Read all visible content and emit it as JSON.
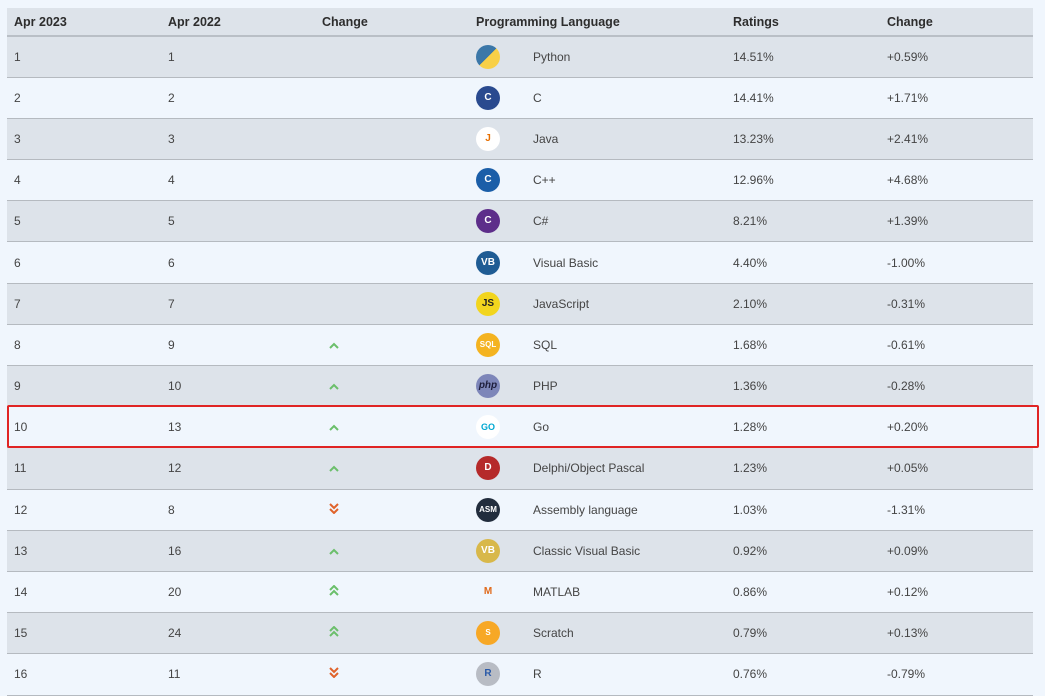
{
  "headers": [
    "Apr 2023",
    "Apr 2022",
    "Change",
    "Programming Language",
    "Ratings",
    "Change"
  ],
  "rows": [
    {
      "apr2023": "1",
      "apr2022": "1",
      "trend": "",
      "icon": "python-icon",
      "language": "Python",
      "rating": "14.51%",
      "change": "+0.59%"
    },
    {
      "apr2023": "2",
      "apr2022": "2",
      "trend": "",
      "icon": "c-icon",
      "language": "C",
      "rating": "14.41%",
      "change": "+1.71%"
    },
    {
      "apr2023": "3",
      "apr2022": "3",
      "trend": "",
      "icon": "java-icon",
      "language": "Java",
      "rating": "13.23%",
      "change": "+2.41%"
    },
    {
      "apr2023": "4",
      "apr2022": "4",
      "trend": "",
      "icon": "cpp-icon",
      "language": "C++",
      "rating": "12.96%",
      "change": "+4.68%"
    },
    {
      "apr2023": "5",
      "apr2022": "5",
      "trend": "",
      "icon": "csharp-icon",
      "language": "C#",
      "rating": "8.21%",
      "change": "+1.39%"
    },
    {
      "apr2023": "6",
      "apr2022": "6",
      "trend": "",
      "icon": "visual-basic-icon",
      "language": "Visual Basic",
      "rating": "4.40%",
      "change": "-1.00%"
    },
    {
      "apr2023": "7",
      "apr2022": "7",
      "trend": "",
      "icon": "javascript-icon",
      "language": "JavaScript",
      "rating": "2.10%",
      "change": "-0.31%"
    },
    {
      "apr2023": "8",
      "apr2022": "9",
      "trend": "up",
      "icon": "sql-icon",
      "language": "SQL",
      "rating": "1.68%",
      "change": "-0.61%"
    },
    {
      "apr2023": "9",
      "apr2022": "10",
      "trend": "up",
      "icon": "php-icon",
      "language": "PHP",
      "rating": "1.36%",
      "change": "-0.28%"
    },
    {
      "apr2023": "10",
      "apr2022": "13",
      "trend": "up",
      "icon": "go-icon",
      "language": "Go",
      "rating": "1.28%",
      "change": "+0.20%"
    },
    {
      "apr2023": "11",
      "apr2022": "12",
      "trend": "up",
      "icon": "delphi-icon",
      "language": "Delphi/Object Pascal",
      "rating": "1.23%",
      "change": "+0.05%"
    },
    {
      "apr2023": "12",
      "apr2022": "8",
      "trend": "down2",
      "icon": "assembly-icon",
      "language": "Assembly language",
      "rating": "1.03%",
      "change": "-1.31%"
    },
    {
      "apr2023": "13",
      "apr2022": "16",
      "trend": "up",
      "icon": "classic-vb-icon",
      "language": "Classic Visual Basic",
      "rating": "0.92%",
      "change": "+0.09%"
    },
    {
      "apr2023": "14",
      "apr2022": "20",
      "trend": "up2",
      "icon": "matlab-icon",
      "language": "MATLAB",
      "rating": "0.86%",
      "change": "+0.12%"
    },
    {
      "apr2023": "15",
      "apr2022": "24",
      "trend": "up2",
      "icon": "scratch-icon",
      "language": "Scratch",
      "rating": "0.79%",
      "change": "+0.13%"
    },
    {
      "apr2023": "16",
      "apr2022": "11",
      "trend": "down2",
      "icon": "r-icon",
      "language": "R",
      "rating": "0.76%",
      "change": "-0.79%"
    }
  ],
  "icon_glyphs": {
    "python-icon": "Py",
    "c-icon": "C",
    "java-icon": "J",
    "cpp-icon": "C",
    "csharp-icon": "C",
    "visual-basic-icon": "VB",
    "javascript-icon": "JS",
    "sql-icon": "SQL",
    "php-icon": "php",
    "go-icon": "GO",
    "delphi-icon": "D",
    "assembly-icon": "ASM",
    "classic-vb-icon": "VB",
    "matlab-icon": "M",
    "scratch-icon": "S",
    "r-icon": "R"
  },
  "icon_colors": {
    "python-icon": "#3b77a8",
    "c-icon": "#2a4a8f",
    "java-icon": "#e76f00",
    "cpp-icon": "#1b5ea8",
    "csharp-icon": "#5d2e8a",
    "visual-basic-icon": "#1f5c94",
    "javascript-icon": "#f2d51e",
    "sql-icon": "#f4b320",
    "php-icon": "#7d86b9",
    "go-icon": "#00a8d1",
    "delphi-icon": "#b52a2a",
    "assembly-icon": "#222d3d",
    "classic-vb-icon": "#8a5a3a",
    "matlab-icon": "#e06a1b",
    "scratch-icon": "#f7a826",
    "r-icon": "#5570a8"
  },
  "highlight_color": "#e02424"
}
